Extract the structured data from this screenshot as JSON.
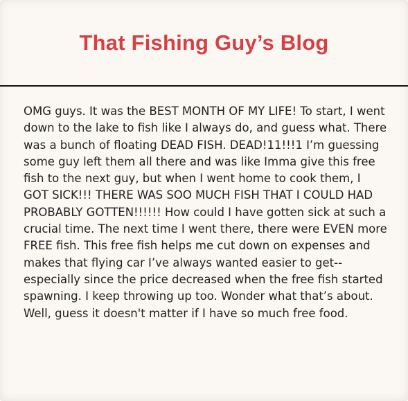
{
  "header": {
    "title": "That Fishing Guy’s Blog"
  },
  "post": {
    "body": "OMG guys. It was the BEST MONTH OF MY LIFE! To start, I went down to the lake to fish like I always do, and guess what. There was a bunch of floating DEAD FISH. DEAD!11!!!1 I’m guessing some guy left them all there and was like Imma give this free fish to the next guy, but when I went home to cook them, I GOT SICK!!! THERE WAS SOO MUCH FISH THAT I COULD HAD PROBABLY GOTTEN!!!!!! How could I have gotten sick at such a crucial time. The next time I went there, there were EVEN more FREE fish. This free fish helps me cut down on expenses and makes that flying car I’ve always wanted easier to get--especially since the price decreased when the free fish started spawning. I keep throwing up too. Wonder what that’s about. Well, guess it doesn't matter if I have so much free food."
  },
  "colors": {
    "title": "#d64045",
    "text": "#222222",
    "background": "#fbf8f4",
    "divider": "#111111"
  }
}
